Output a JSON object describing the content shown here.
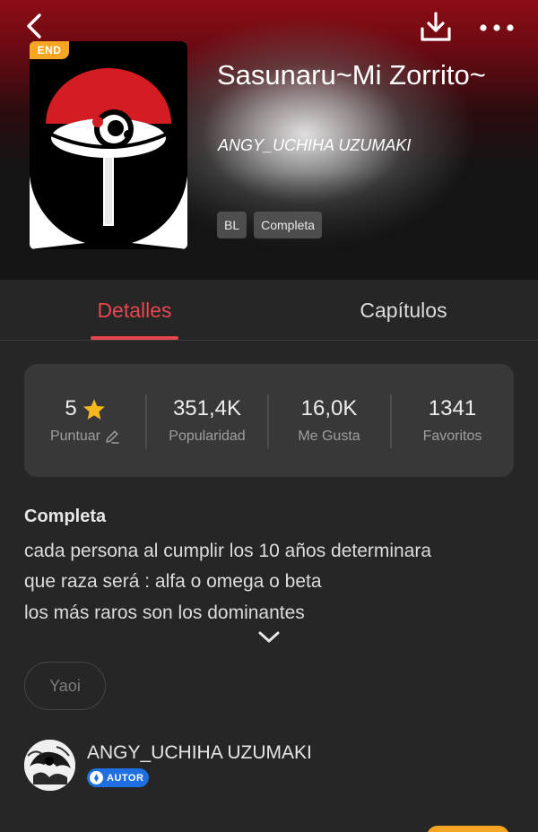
{
  "header": {
    "end_badge": "END",
    "title": "Sasunaru~Mi Zorrito~",
    "author": "ANGY_UCHIHA UZUMAKI",
    "tags": [
      "BL",
      "Completa"
    ]
  },
  "tabs": [
    {
      "label": "Detalles",
      "active": true
    },
    {
      "label": "Capítulos",
      "active": false
    }
  ],
  "stats": [
    {
      "value": "5",
      "label": "Puntuar"
    },
    {
      "value": "351,4K",
      "label": "Popularidad"
    },
    {
      "value": "16,0K",
      "label": "Me Gusta"
    },
    {
      "value": "1341",
      "label": "Favoritos"
    }
  ],
  "description": {
    "status": "Completa",
    "lines": [
      "cada persona al cumplir los 10 años determinara",
      "que raza será : alfa o omega o beta",
      "los más raros son los dominantes"
    ]
  },
  "genre_tag": "Yaoi",
  "author_section": {
    "name": "ANGY_UCHIHA UZUMAKI",
    "badge": "AUTOR"
  },
  "icons": {
    "back": "chevron-left-icon",
    "download": "download-icon",
    "more": "more-horizontal-icon",
    "star": "star-icon",
    "edit": "pencil-icon",
    "expand": "chevron-down-icon"
  },
  "colors": {
    "accent": "#e6464e",
    "star": "#f5b81c",
    "badge": "#1f6fe0",
    "end_badge": "#f5a623"
  }
}
